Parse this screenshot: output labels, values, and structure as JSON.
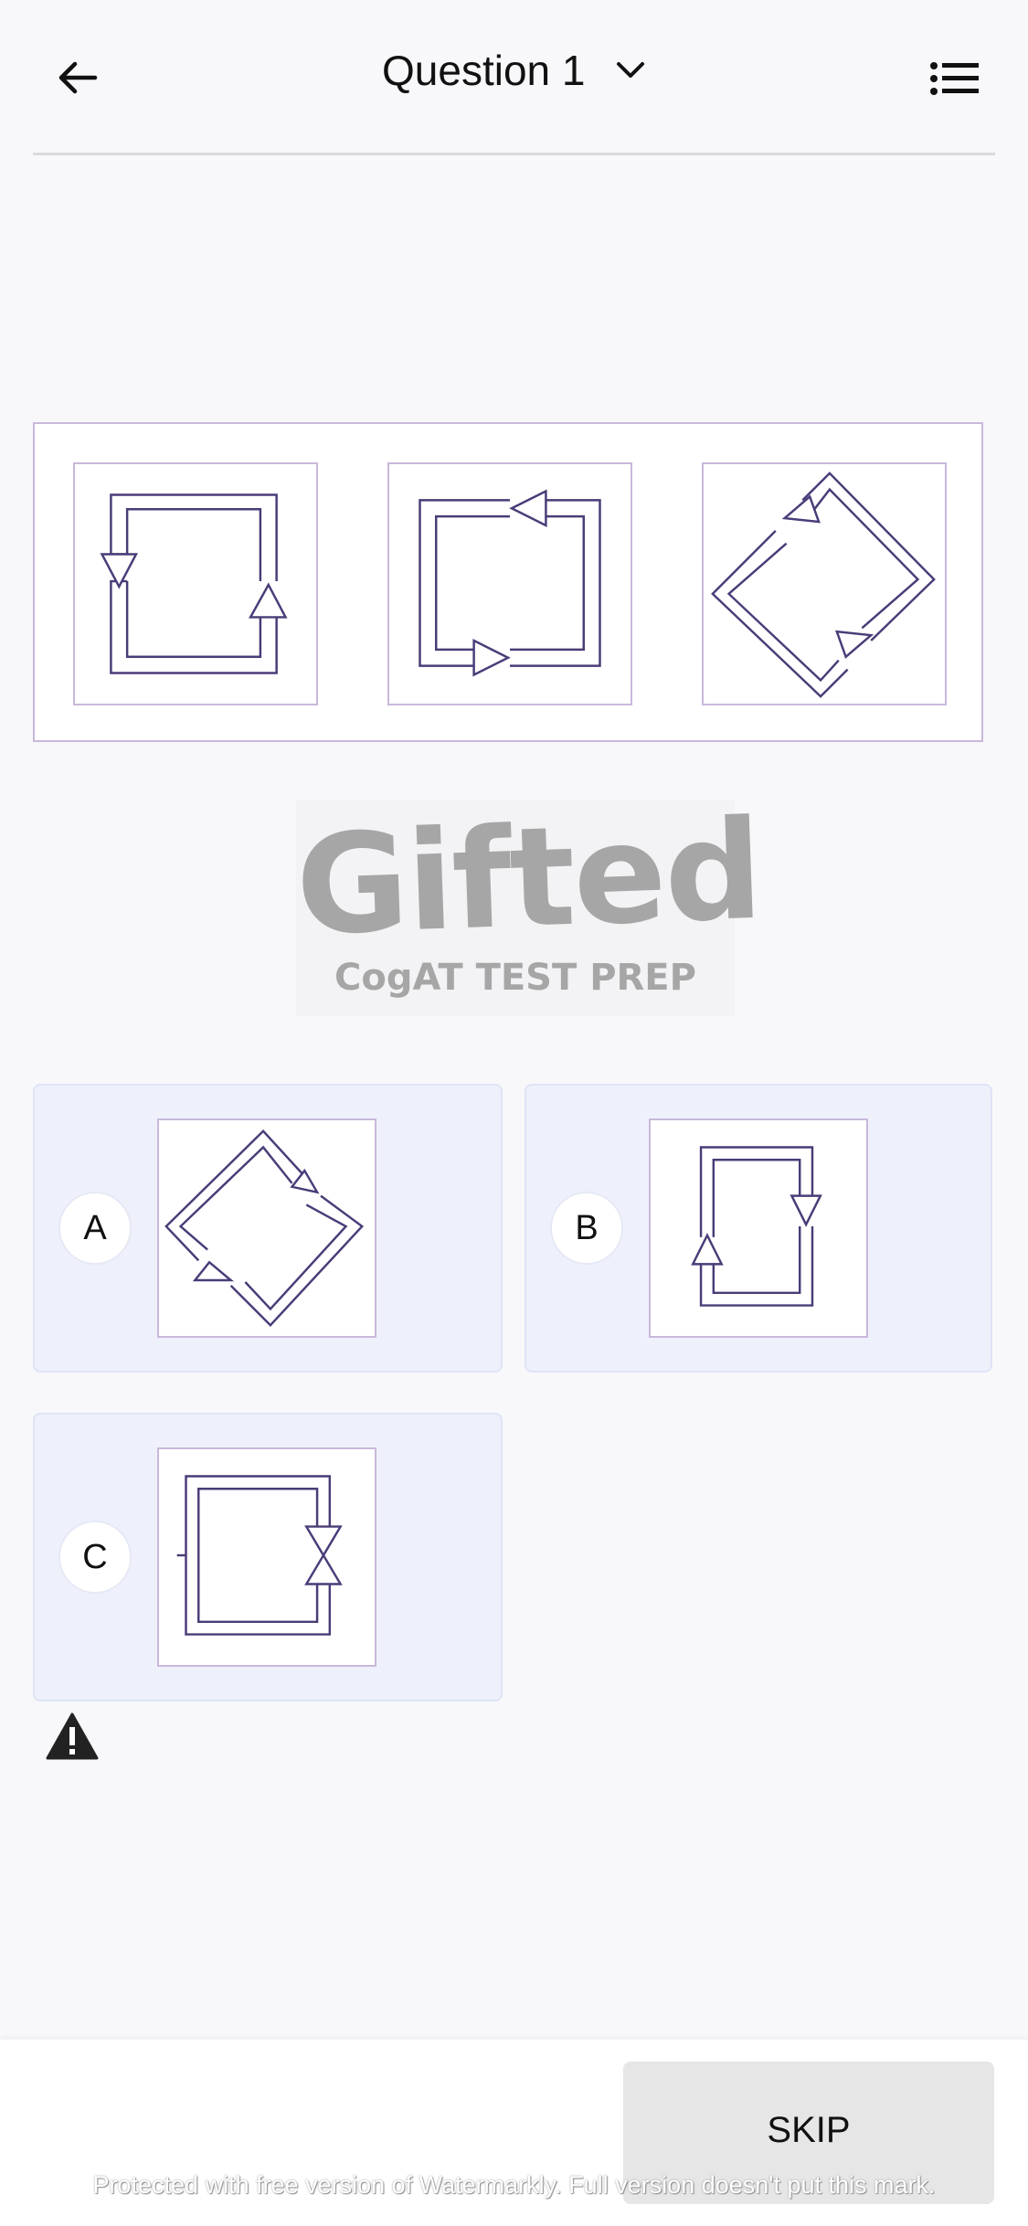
{
  "header": {
    "title": "Question 1",
    "back_icon": "arrow-left-icon",
    "dropdown_icon": "chevron-down-icon",
    "list_icon": "list-icon"
  },
  "question": {
    "figures": [
      "square-loop-arrows-left-right",
      "square-loop-arrows-top-bottom",
      "diamond-loop-arrows"
    ]
  },
  "logo": {
    "word": "Gifted",
    "subtitle": "CogAT TEST PREP"
  },
  "options": [
    {
      "letter": "A",
      "figure": "diamond-loop-arrows"
    },
    {
      "letter": "B",
      "figure": "rect-loop-arrows-sides"
    },
    {
      "letter": "C",
      "figure": "rect-loop-arrows-hourglass"
    }
  ],
  "warning_icon": "warning-triangle-icon",
  "footer": {
    "skip_label": "SKIP",
    "watermark": "Protected with free version of Watermarkly. Full version doesn't put this mark."
  },
  "colors": {
    "accent_stroke": "#4a3c78",
    "frame_border": "#c9b8da",
    "option_bg": "#eef1fb",
    "background": "#f8f8fb"
  }
}
